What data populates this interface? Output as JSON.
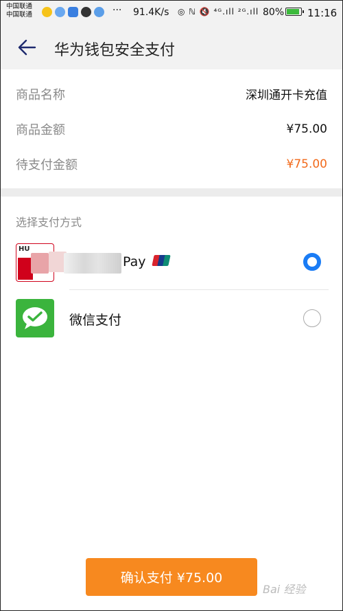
{
  "status_bar": {
    "carrier_1": "中国联通",
    "carrier_2": "中国联通",
    "more": "···",
    "network_speed": "91.4K/s",
    "signal_info": "◎ ℕ 🔇 ⁴ᴳ.ıll ²ᴳ.ıll",
    "battery_percent": "80%",
    "time": "11:16",
    "battery_color": "#3cba3c"
  },
  "app_bar": {
    "back_icon": "arrow-left-icon",
    "title": "华为钱包安全支付"
  },
  "order": {
    "rows": [
      {
        "label": "商品名称",
        "value": "深圳通开卡充值"
      },
      {
        "label": "商品金额",
        "value": "¥75.00"
      },
      {
        "label": "待支付金额",
        "value": "¥75.00"
      }
    ],
    "accent_color": "#f26a1b"
  },
  "payment": {
    "section_title": "选择支付方式",
    "options": [
      {
        "name": "Pay",
        "logo_text": "HU",
        "selected": true
      },
      {
        "name": "微信支付",
        "selected": false
      }
    ],
    "radio_color": "#1a7cf5"
  },
  "confirm": {
    "label": "确认支付 ¥75.00",
    "color": "#f7891f"
  },
  "watermark": {
    "text": "Bai 经验"
  }
}
